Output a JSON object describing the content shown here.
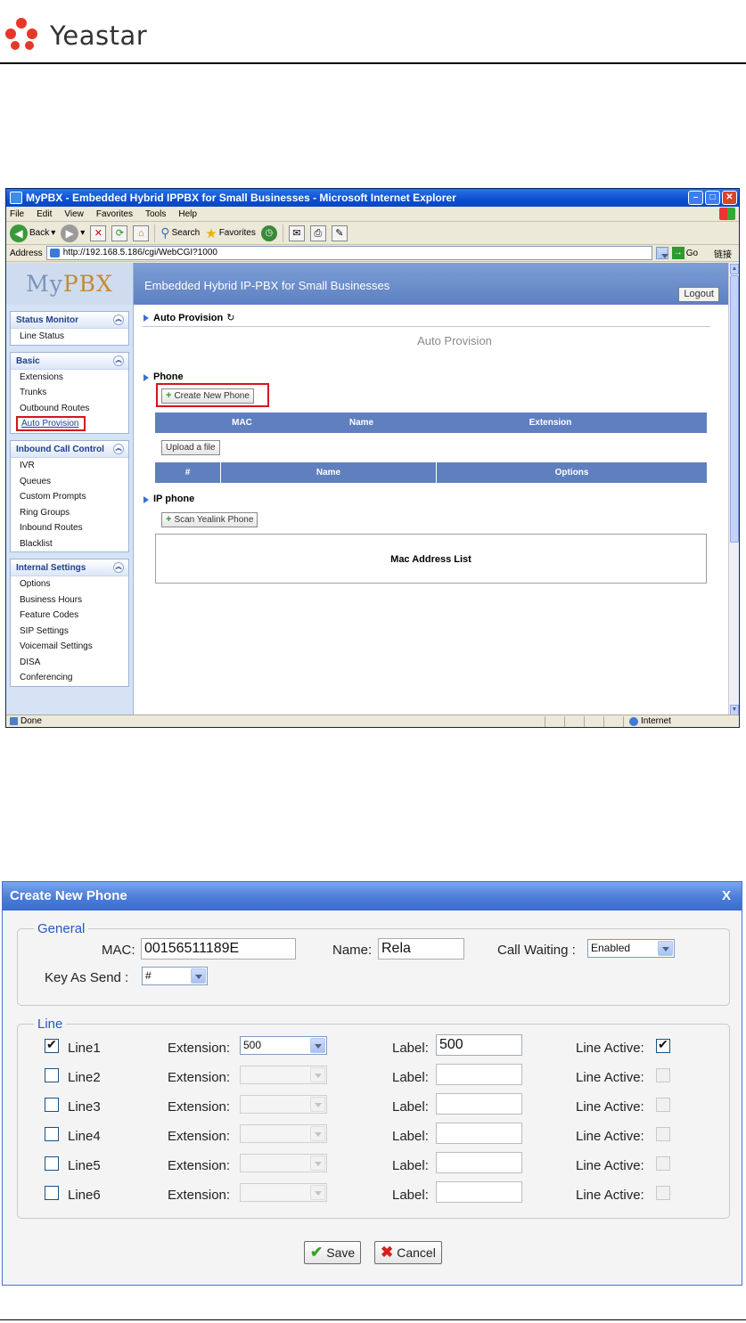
{
  "doc": {
    "logo_text": "Yeastar"
  },
  "browser": {
    "title": "MyPBX - Embedded Hybrid IPPBX for Small Businesses - Microsoft Internet Explorer",
    "menu": [
      "File",
      "Edit",
      "View",
      "Favorites",
      "Tools",
      "Help"
    ],
    "toolbar": {
      "back": "Back",
      "search": "Search",
      "favorites": "Favorites"
    },
    "address_label": "Address",
    "url": "http://192.168.5.186/cgi/WebCGI?1000",
    "go": "Go",
    "links": "链接",
    "status_left": "Done",
    "status_zone": "Internet"
  },
  "pbx": {
    "logo_a": "My",
    "logo_b": "PBX",
    "header": "Embedded Hybrid IP-PBX for Small Businesses",
    "logout": "Logout",
    "sidebar": [
      {
        "title": "Status Monitor",
        "items": [
          "Line Status"
        ]
      },
      {
        "title": "Basic",
        "items": [
          "Extensions",
          "Trunks",
          "Outbound Routes",
          "Auto Provision"
        ]
      },
      {
        "title": "Inbound Call Control",
        "items": [
          "IVR",
          "Queues",
          "Custom Prompts",
          "Ring Groups",
          "Inbound Routes",
          "Blacklist"
        ]
      },
      {
        "title": "Internal Settings",
        "items": [
          "Options",
          "Business Hours",
          "Feature Codes",
          "SIP Settings",
          "Voicemail Settings",
          "DISA",
          "Conferencing"
        ]
      }
    ],
    "crumb": "Auto Provision",
    "page_title": "Auto Provision",
    "phone_section": "Phone",
    "create_new_phone": "Create New Phone",
    "phone_cols": [
      "MAC",
      "Name",
      "Extension"
    ],
    "upload": "Upload a file",
    "file_cols": [
      "#",
      "Name",
      "Options"
    ],
    "ip_section": "IP phone",
    "scan": "Scan Yealink Phone",
    "mac_list": "Mac Address List"
  },
  "dialog": {
    "title": "Create New Phone",
    "close": "X",
    "general_legend": "General",
    "mac_label": "MAC:",
    "mac_value": "00156511189E",
    "name_label": "Name:",
    "name_value": "Rela",
    "call_waiting_label": "Call Waiting :",
    "call_waiting_value": "Enabled",
    "key_send_label": "Key As Send :",
    "key_send_value": "#",
    "line_legend": "Line",
    "ext_label": "Extension:",
    "label_label": "Label:",
    "active_label": "Line Active:",
    "lines": [
      {
        "name": "Line1",
        "checked": true,
        "extension": "500",
        "label": "500",
        "active": true
      },
      {
        "name": "Line2",
        "checked": false,
        "extension": "",
        "label": "",
        "active": false
      },
      {
        "name": "Line3",
        "checked": false,
        "extension": "",
        "label": "",
        "active": false
      },
      {
        "name": "Line4",
        "checked": false,
        "extension": "",
        "label": "",
        "active": false
      },
      {
        "name": "Line5",
        "checked": false,
        "extension": "",
        "label": "",
        "active": false
      },
      {
        "name": "Line6",
        "checked": false,
        "extension": "",
        "label": "",
        "active": false
      }
    ],
    "save": "Save",
    "cancel": "Cancel"
  }
}
